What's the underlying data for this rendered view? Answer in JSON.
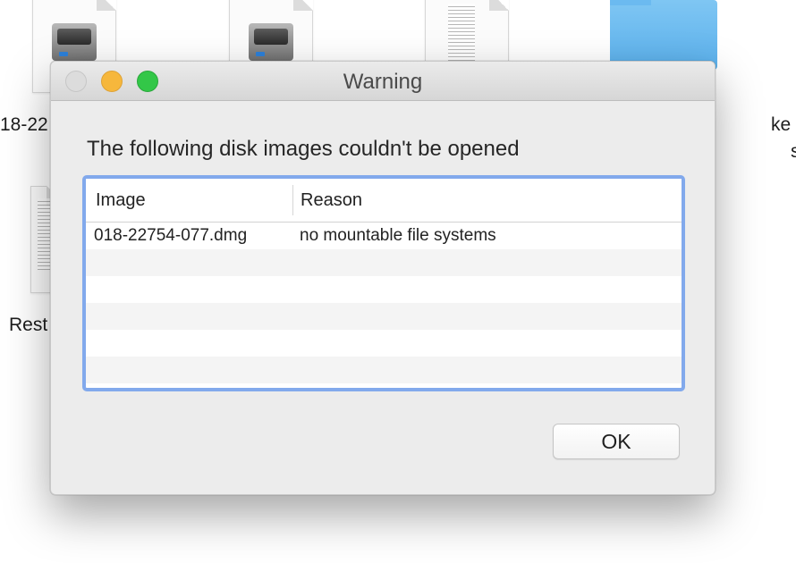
{
  "desktop": {
    "labels": {
      "left_top": "18-22",
      "left_bottom": "Rest",
      "right_top": "ke",
      "right_sub": "s"
    }
  },
  "dialog": {
    "title": "Warning",
    "message": "The following disk images couldn't be opened",
    "table": {
      "columns": [
        "Image",
        "Reason"
      ],
      "rows": [
        {
          "image": "018-22754-077.dmg",
          "reason": "no mountable file systems"
        }
      ],
      "empty_rows": 5
    },
    "ok_label": "OK"
  },
  "colors": {
    "dialog_bg": "#ececec",
    "focus_ring": "#82a9ec",
    "close_button": "#dcdcdc",
    "minimize_button": "#f6b73c",
    "maximize_button": "#33c748",
    "folder": "#5ab0ec"
  }
}
